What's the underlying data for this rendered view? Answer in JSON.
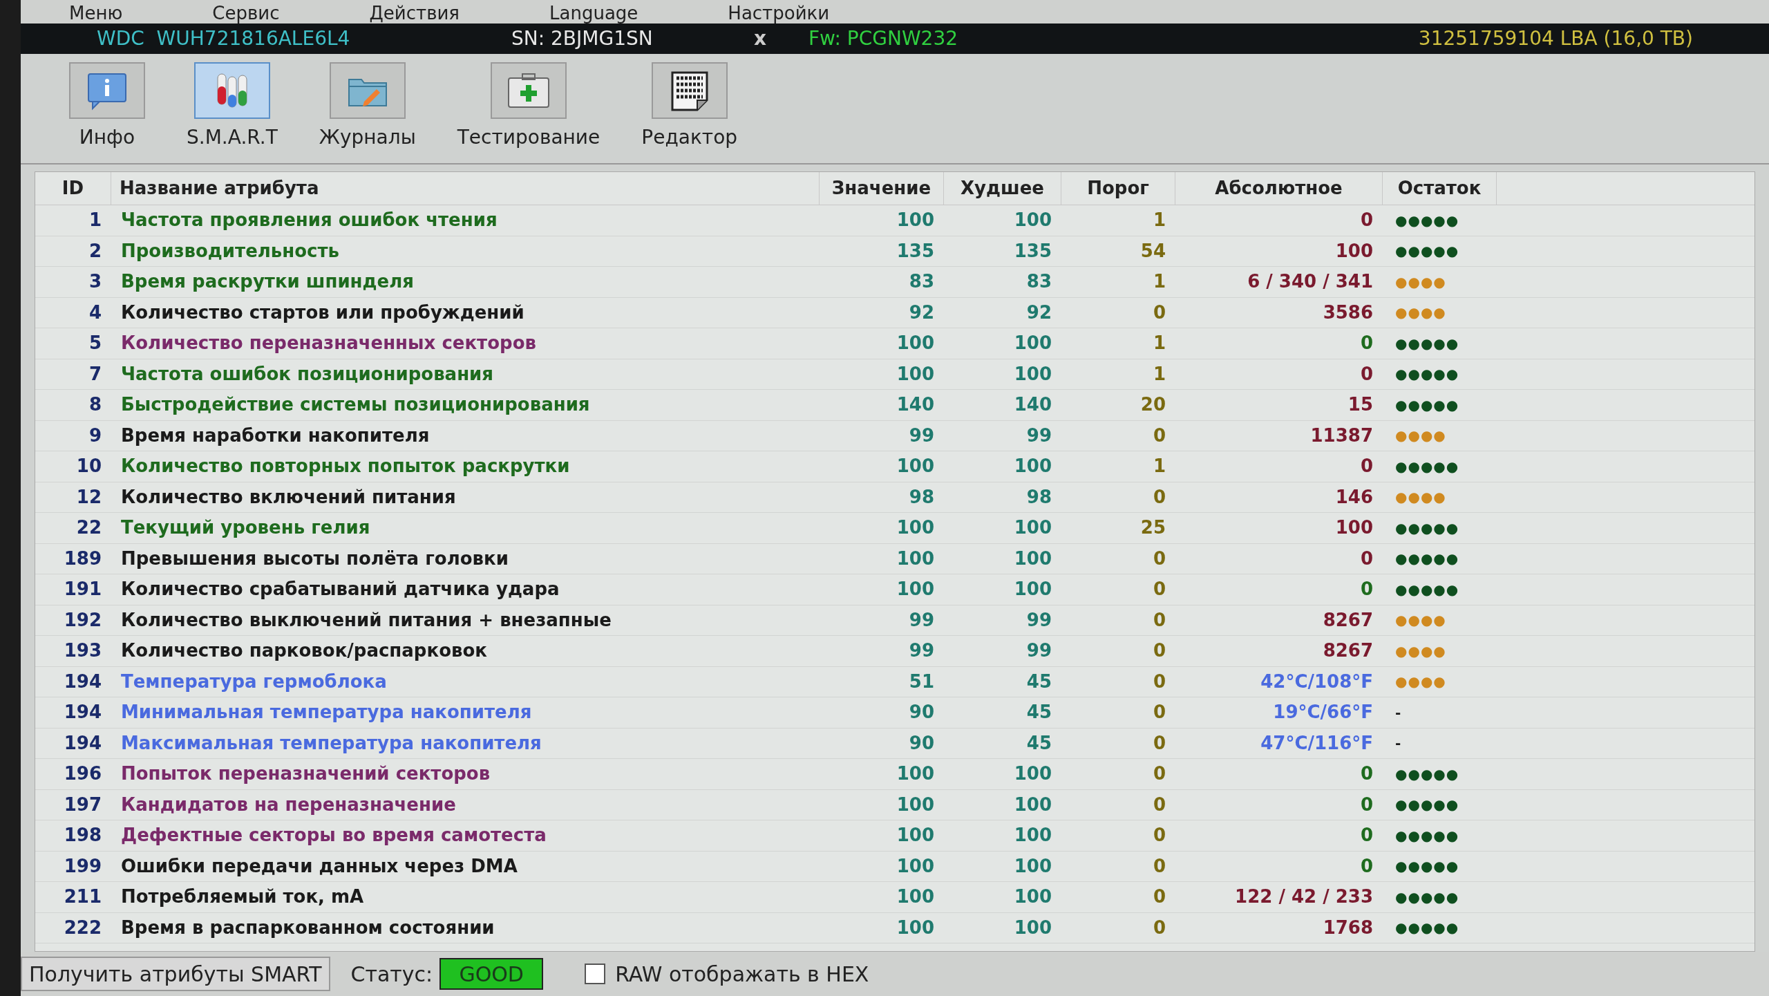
{
  "menu": [
    "Меню",
    "Сервис",
    "Действия",
    "Language",
    "Настройки"
  ],
  "drive_bar": {
    "model": "WDC  WUH721816ALE6L4",
    "serial": "SN: 2BJMG1SN",
    "close": "x",
    "firmware": "Fw: PCGNW232",
    "capacity": "31251759104 LBA (16,0 TB)"
  },
  "toolbar": [
    {
      "label": "Инфо",
      "kind": "info",
      "selected": false
    },
    {
      "label": "S.M.A.R.T",
      "kind": "smart",
      "selected": true
    },
    {
      "label": "Журналы",
      "kind": "logs",
      "selected": false
    },
    {
      "label": "Тестирование",
      "kind": "test",
      "selected": false
    },
    {
      "label": "Редактор",
      "kind": "editor",
      "selected": false
    }
  ],
  "table": {
    "columns": [
      "ID",
      "Название атрибута",
      "Значение",
      "Худшее",
      "Порог",
      "Абсолютное",
      "Остаток"
    ],
    "rows": [
      {
        "id": "1",
        "name": {
          "text": "Частота проявления ошибок чтения",
          "color": "#1e6b1e"
        },
        "value": "100",
        "worst": "100",
        "threshold": "1",
        "absolute": {
          "text": "0",
          "color": "#7a1a2e"
        },
        "remaining": {
          "text": "●●●●●",
          "color": "#0f4f1f"
        }
      },
      {
        "id": "2",
        "name": {
          "text": "Производительность",
          "color": "#1e6b1e"
        },
        "value": "135",
        "worst": "135",
        "threshold": "54",
        "absolute": {
          "text": "100",
          "color": "#7a1a2e"
        },
        "remaining": {
          "text": "●●●●●",
          "color": "#0f4f1f"
        }
      },
      {
        "id": "3",
        "name": {
          "text": "Время раскрутки шпинделя",
          "color": "#1e6b1e"
        },
        "value": "83",
        "worst": "83",
        "threshold": "1",
        "absolute": {
          "text": "6 / 340 / 341",
          "color": "#7a1a2e"
        },
        "remaining": {
          "text": "●●●●",
          "color": "#d08a20"
        }
      },
      {
        "id": "4",
        "name": {
          "text": "Количество стартов или пробуждений",
          "color": "#1a1a1a"
        },
        "value": "92",
        "worst": "92",
        "threshold": "0",
        "absolute": {
          "text": "3586",
          "color": "#7a1a2e"
        },
        "remaining": {
          "text": "●●●●",
          "color": "#d08a20"
        }
      },
      {
        "id": "5",
        "name": {
          "text": "Количество переназначенных секторов",
          "color": "#7a2a6a"
        },
        "value": "100",
        "worst": "100",
        "threshold": "1",
        "absolute": {
          "text": "0",
          "color": "#1e6b1e"
        },
        "remaining": {
          "text": "●●●●●",
          "color": "#0f4f1f"
        }
      },
      {
        "id": "7",
        "name": {
          "text": "Частота ошибок позиционирования",
          "color": "#1e6b1e"
        },
        "value": "100",
        "worst": "100",
        "threshold": "1",
        "absolute": {
          "text": "0",
          "color": "#7a1a2e"
        },
        "remaining": {
          "text": "●●●●●",
          "color": "#0f4f1f"
        }
      },
      {
        "id": "8",
        "name": {
          "text": "Быстродействие системы позиционирования",
          "color": "#1e6b1e"
        },
        "value": "140",
        "worst": "140",
        "threshold": "20",
        "absolute": {
          "text": "15",
          "color": "#7a1a2e"
        },
        "remaining": {
          "text": "●●●●●",
          "color": "#0f4f1f"
        }
      },
      {
        "id": "9",
        "name": {
          "text": "Время наработки накопителя",
          "color": "#1a1a1a"
        },
        "value": "99",
        "worst": "99",
        "threshold": "0",
        "absolute": {
          "text": "11387",
          "color": "#7a1a2e"
        },
        "remaining": {
          "text": "●●●●",
          "color": "#d08a20"
        }
      },
      {
        "id": "10",
        "name": {
          "text": "Количество повторных попыток раскрутки",
          "color": "#1e6b1e"
        },
        "value": "100",
        "worst": "100",
        "threshold": "1",
        "absolute": {
          "text": "0",
          "color": "#7a1a2e"
        },
        "remaining": {
          "text": "●●●●●",
          "color": "#0f4f1f"
        }
      },
      {
        "id": "12",
        "name": {
          "text": "Количество включений питания",
          "color": "#1a1a1a"
        },
        "value": "98",
        "worst": "98",
        "threshold": "0",
        "absolute": {
          "text": "146",
          "color": "#7a1a2e"
        },
        "remaining": {
          "text": "●●●●",
          "color": "#d08a20"
        }
      },
      {
        "id": "22",
        "name": {
          "text": "Текущий уровень гелия",
          "color": "#1e6b1e"
        },
        "value": "100",
        "worst": "100",
        "threshold": "25",
        "absolute": {
          "text": "100",
          "color": "#7a1a2e"
        },
        "remaining": {
          "text": "●●●●●",
          "color": "#0f4f1f"
        }
      },
      {
        "id": "189",
        "name": {
          "text": "Превышения высоты полёта головки",
          "color": "#1a1a1a"
        },
        "value": "100",
        "worst": "100",
        "threshold": "0",
        "absolute": {
          "text": "0",
          "color": "#7a1a2e"
        },
        "remaining": {
          "text": "●●●●●",
          "color": "#0f4f1f"
        }
      },
      {
        "id": "191",
        "name": {
          "text": "Количество срабатываний датчика удара",
          "color": "#1a1a1a"
        },
        "value": "100",
        "worst": "100",
        "threshold": "0",
        "absolute": {
          "text": "0",
          "color": "#1e6b1e"
        },
        "remaining": {
          "text": "●●●●●",
          "color": "#0f4f1f"
        }
      },
      {
        "id": "192",
        "name": {
          "text": "Количество выключений питания + внезапные",
          "color": "#1a1a1a"
        },
        "value": "99",
        "worst": "99",
        "threshold": "0",
        "absolute": {
          "text": "8267",
          "color": "#7a1a2e"
        },
        "remaining": {
          "text": "●●●●",
          "color": "#d08a20"
        }
      },
      {
        "id": "193",
        "name": {
          "text": "Количество парковок/распарковок",
          "color": "#1a1a1a"
        },
        "value": "99",
        "worst": "99",
        "threshold": "0",
        "absolute": {
          "text": "8267",
          "color": "#7a1a2e"
        },
        "remaining": {
          "text": "●●●●",
          "color": "#d08a20"
        }
      },
      {
        "id": "194",
        "name": {
          "text": "Температура гермоблока",
          "color": "#4a6adf"
        },
        "value": "51",
        "worst": "45",
        "threshold": "0",
        "absolute": {
          "text": "42°C/108°F",
          "color": "#4a6adf"
        },
        "remaining": {
          "text": "●●●●",
          "color": "#d08a20"
        }
      },
      {
        "id": "194",
        "name": {
          "text": "Минимальная температура накопителя",
          "color": "#4a6adf"
        },
        "value": "90",
        "worst": "45",
        "threshold": "0",
        "absolute": {
          "text": "19°C/66°F",
          "color": "#4a6adf"
        },
        "remaining": {
          "text": "-",
          "color": "#1a1a1a"
        }
      },
      {
        "id": "194",
        "name": {
          "text": "Максимальная температура накопителя",
          "color": "#4a6adf"
        },
        "value": "90",
        "worst": "45",
        "threshold": "0",
        "absolute": {
          "text": "47°C/116°F",
          "color": "#4a6adf"
        },
        "remaining": {
          "text": "-",
          "color": "#1a1a1a"
        }
      },
      {
        "id": "196",
        "name": {
          "text": "Попыток переназначений секторов",
          "color": "#7a2a6a"
        },
        "value": "100",
        "worst": "100",
        "threshold": "0",
        "absolute": {
          "text": "0",
          "color": "#1e6b1e"
        },
        "remaining": {
          "text": "●●●●●",
          "color": "#0f4f1f"
        }
      },
      {
        "id": "197",
        "name": {
          "text": "Кандидатов на переназначение",
          "color": "#7a2a6a"
        },
        "value": "100",
        "worst": "100",
        "threshold": "0",
        "absolute": {
          "text": "0",
          "color": "#1e6b1e"
        },
        "remaining": {
          "text": "●●●●●",
          "color": "#0f4f1f"
        }
      },
      {
        "id": "198",
        "name": {
          "text": "Дефектные секторы во время самотеста",
          "color": "#7a2a6a"
        },
        "value": "100",
        "worst": "100",
        "threshold": "0",
        "absolute": {
          "text": "0",
          "color": "#1e6b1e"
        },
        "remaining": {
          "text": "●●●●●",
          "color": "#0f4f1f"
        }
      },
      {
        "id": "199",
        "name": {
          "text": "Ошибки передачи данных через DMA",
          "color": "#1a1a1a"
        },
        "value": "100",
        "worst": "100",
        "threshold": "0",
        "absolute": {
          "text": "0",
          "color": "#1e6b1e"
        },
        "remaining": {
          "text": "●●●●●",
          "color": "#0f4f1f"
        }
      },
      {
        "id": "211",
        "name": {
          "text": "Потребляемый ток, mA",
          "color": "#1a1a1a"
        },
        "value": "100",
        "worst": "100",
        "threshold": "0",
        "absolute": {
          "text": "122 / 42 / 233",
          "color": "#7a1a2e"
        },
        "remaining": {
          "text": "●●●●●",
          "color": "#0f4f1f"
        }
      },
      {
        "id": "222",
        "name": {
          "text": "Время в распаркованном состоянии",
          "color": "#1a1a1a"
        },
        "value": "100",
        "worst": "100",
        "threshold": "0",
        "absolute": {
          "text": "1768",
          "color": "#7a1a2e"
        },
        "remaining": {
          "text": "●●●●●",
          "color": "#0f4f1f"
        }
      }
    ]
  },
  "bottom_bar": {
    "button": "Получить атрибуты SMART",
    "status_label": "Статус:",
    "status": "GOOD",
    "hex_checkbox": {
      "label": "RAW отображать в HEX",
      "checked": false
    }
  }
}
